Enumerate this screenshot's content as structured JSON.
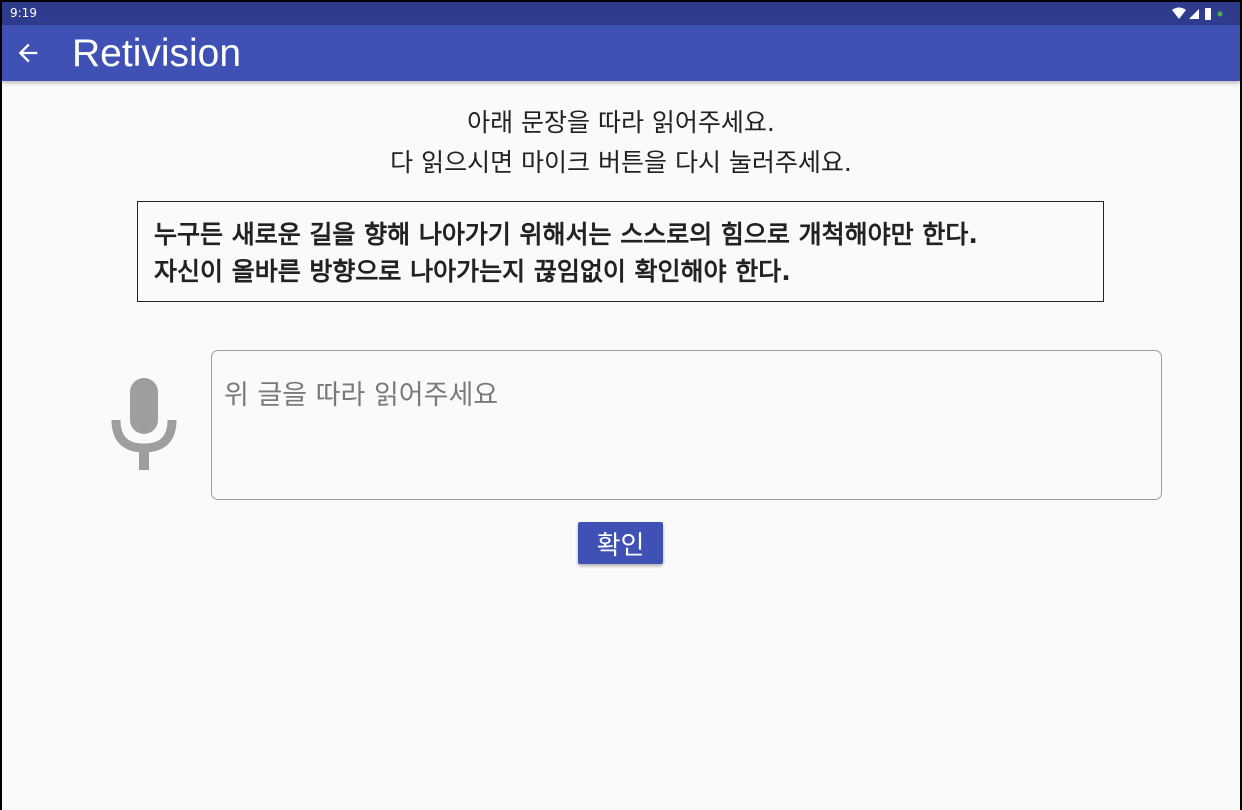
{
  "status_bar": {
    "time": "9:19",
    "icons": [
      "wifi-icon",
      "cell-signal-icon",
      "battery-icon",
      "notification-dot-icon"
    ]
  },
  "app_bar": {
    "title": "Retivision",
    "back_icon": "arrow-back-icon",
    "color": "#3f51b5"
  },
  "instructions": {
    "line1": "아래 문장을 따라 읽어주세요.",
    "line2": "다 읽으시면 마이크 버튼을 다시 눌러주세요."
  },
  "sentence": {
    "line1": "누구든 새로운 길을 향해 나아가기 위해서는 스스로의 힘으로 개척해야만 한다.",
    "line2": "자신이 올바른 방향으로 나아가는지 끊임없이 확인해야 한다."
  },
  "mic": {
    "icon": "microphone-icon",
    "color": "#9e9e9e"
  },
  "speech_input": {
    "value": "",
    "placeholder": "위 글을 따라 읽어주세요"
  },
  "confirm_button": {
    "label": "확인"
  }
}
